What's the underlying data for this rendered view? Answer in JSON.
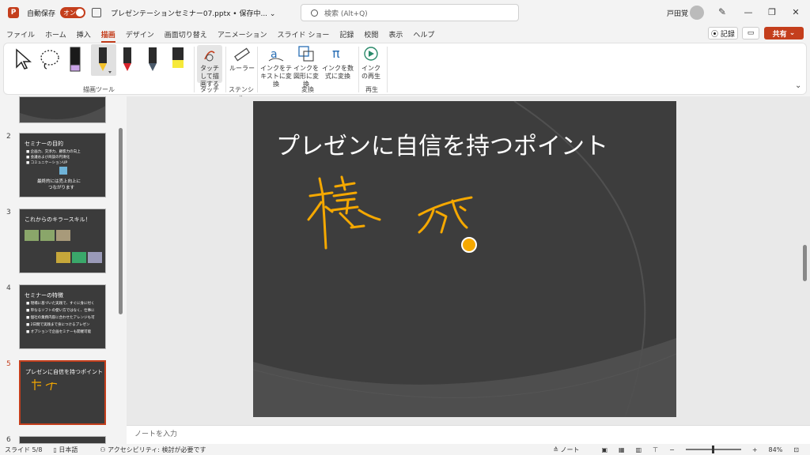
{
  "titlebar": {
    "autosave_label": "自動保存",
    "autosave_state": "オン",
    "doc_title": "プレゼンテーションセミナー07.pptx • 保存中... ⌄",
    "search_placeholder": "検索 (Alt+Q)",
    "user_name": "戸田覚"
  },
  "tabs": [
    "ファイル",
    "ホーム",
    "挿入",
    "描画",
    "デザイン",
    "画面切り替え",
    "アニメーション",
    "スライド ショー",
    "記録",
    "校閲",
    "表示",
    "ヘルプ"
  ],
  "active_tab": "描画",
  "ribbon_actions": {
    "record": "記録",
    "share": "共有"
  },
  "ribbon": {
    "groups": {
      "drawing_tools": "描画ツール",
      "touch": "タッチ",
      "stencil": "ステンシル",
      "convert": "変換",
      "replay": "再生"
    },
    "buttons": {
      "touch_draw": "タッチして描画する",
      "ruler": "ルーラー",
      "ink_to_text": "インクをテキストに変換",
      "ink_to_shape": "インクを図形に変換",
      "ink_to_math": "インクを数式に変換",
      "ink_replay": "インクの再生"
    },
    "pen_colors": [
      "#1a1a1a",
      "#f3c12a",
      "#d8242c",
      "#4a5a6a",
      "#f6e93a"
    ]
  },
  "thumbnails": [
    {
      "num": "2",
      "title": "セミナーの目的",
      "lines": [
        "■ 企画力、交渉力、顧客力の向上",
        "■ 会議および商談の円滑化",
        "■ コミュニケーションUP",
        "最終的には売上向上に",
        "つながります"
      ]
    },
    {
      "num": "3",
      "title": "これからのキラースキル！",
      "lines": []
    },
    {
      "num": "4",
      "title": "セミナーの特徴",
      "lines": [
        "■ 現場に基づいた実践で、すぐに身に付く",
        "■ 単なるソフトの使い方ではなく、仕事に",
        "■ 個社の業務内容に合わせたアレンジも可",
        "■ 2日間で実践まで身につけるプレゼン",
        "■ オプションで企画セミナーも開催可能"
      ]
    },
    {
      "num": "5",
      "title": "プレゼンに自信を持つポイント",
      "lines": []
    },
    {
      "num": "6",
      "title": "",
      "lines": []
    }
  ],
  "slide": {
    "title": "プレゼンに自信を持つポイント",
    "ink_color": "#f5a800"
  },
  "notes_placeholder": "ノートを入力",
  "status": {
    "slide_count": "スライド 5/8",
    "language": "日本語",
    "accessibility": "アクセシビリティ: 検討が必要です",
    "notes": "ノート",
    "zoom": "84%"
  }
}
